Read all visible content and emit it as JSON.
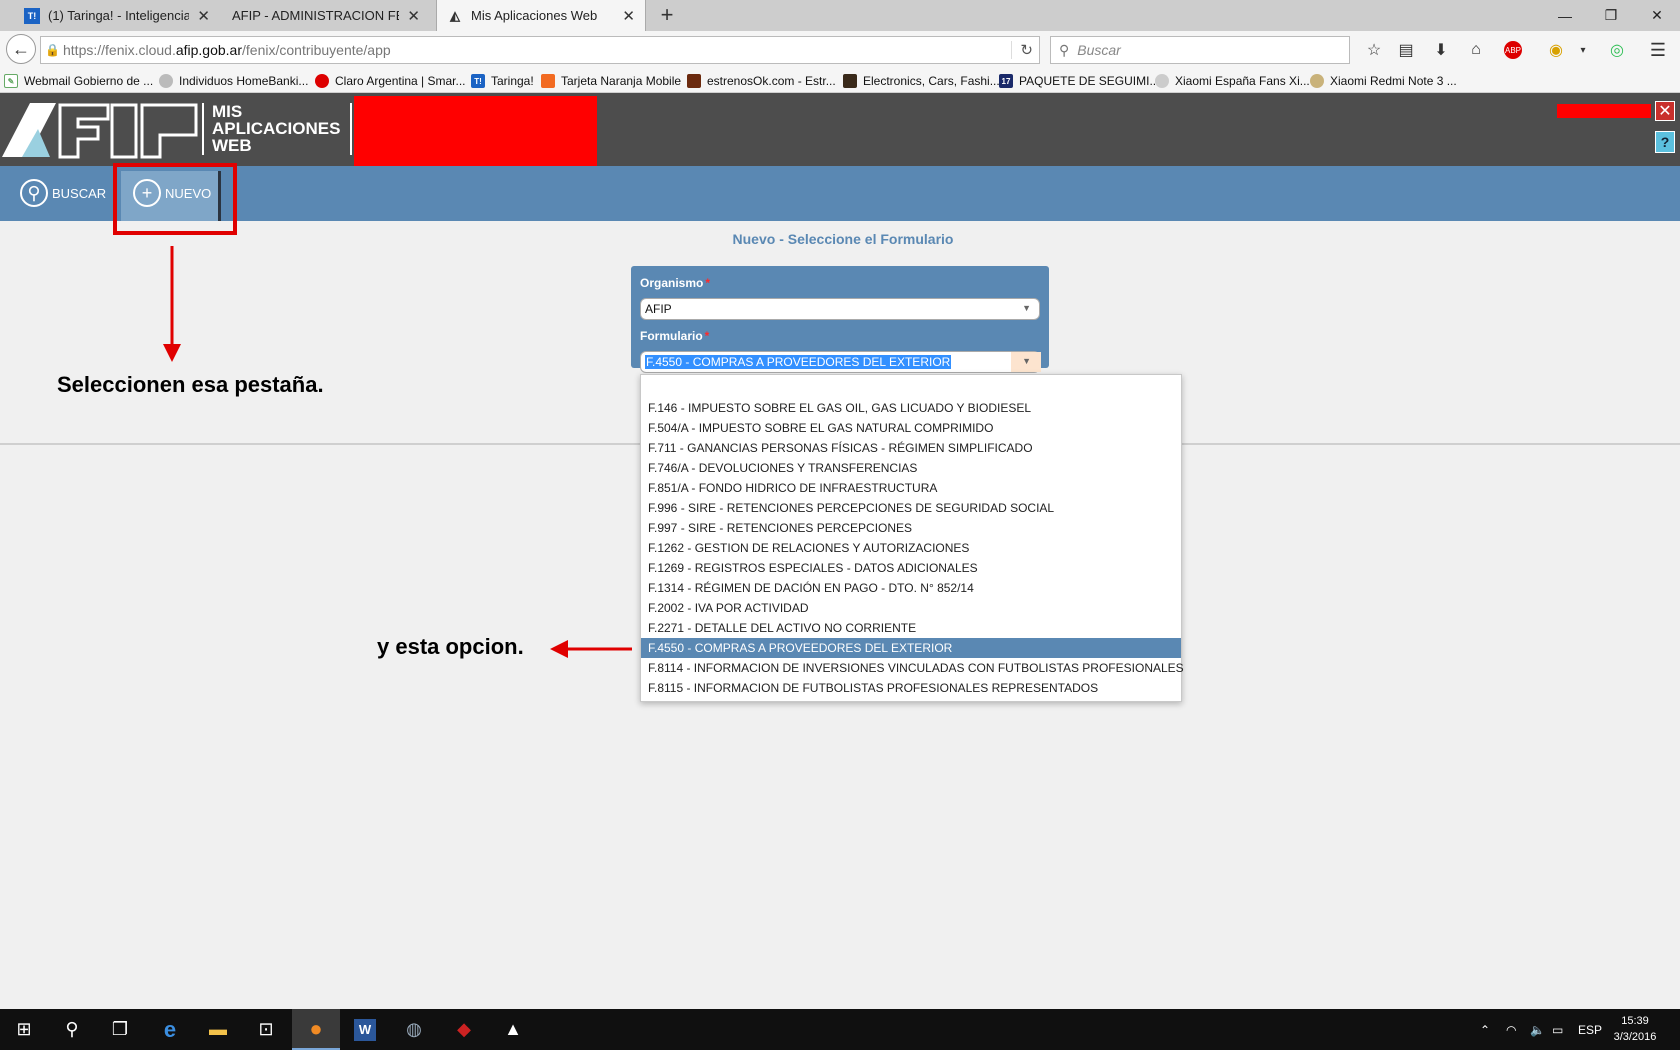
{
  "browser": {
    "tabs": [
      {
        "title": "(1) Taringa! - Inteligencia ...",
        "icon": "T!",
        "active": false
      },
      {
        "title": "AFIP - ADMINISTRACION FED...",
        "icon": "",
        "active": false
      },
      {
        "title": "Mis Aplicaciones Web",
        "icon": "",
        "active": true
      }
    ],
    "url": {
      "prefix": "https://fenix.cloud.",
      "domain": "afip.gob.ar",
      "path": "/fenix/contribuyente/app"
    },
    "search_placeholder": "Buscar",
    "bookmarks": [
      "Webmail Gobierno de ...",
      "Individuos HomeBanki...",
      "Claro Argentina | Smar...",
      "Taringa!",
      "Tarjeta Naranja Mobile",
      "estrenosOk.com - Estr...",
      "Electronics, Cars, Fashi...",
      "PAQUETE DE SEGUIMI...",
      "Xiaomi España Fans Xi...",
      "Xiaomi Redmi Note 3 ..."
    ]
  },
  "app": {
    "name_lines": [
      "MIS",
      "APLICACIONES",
      "WEB"
    ],
    "help_label": "?",
    "toolbar": {
      "buscar": "BUSCAR",
      "nuevo": "NUEVO"
    },
    "page_title": "Nuevo - Seleccione el Formulario",
    "form": {
      "organismo_label": "Organismo",
      "organismo_value": "AFIP",
      "formulario_label": "Formulario",
      "formulario_value": "F.4550 - COMPRAS A PROVEEDORES DEL EXTERIOR",
      "required_mark": "*"
    },
    "dropdown_options": [
      "F.146 - IMPUESTO SOBRE EL GAS OIL, GAS LICUADO Y BIODIESEL",
      "F.504/A - IMPUESTO SOBRE EL GAS NATURAL COMPRIMIDO",
      "F.711 - GANANCIAS PERSONAS FÍSICAS - RÉGIMEN SIMPLIFICADO",
      "F.746/A - DEVOLUCIONES Y TRANSFERENCIAS",
      "F.851/A - FONDO HIDRICO DE INFRAESTRUCTURA",
      "F.996 - SIRE - RETENCIONES PERCEPCIONES DE SEGURIDAD SOCIAL",
      "F.997 - SIRE - RETENCIONES PERCEPCIONES",
      "F.1262 - GESTION DE RELACIONES Y AUTORIZACIONES",
      "F.1269 - REGISTROS ESPECIALES - DATOS ADICIONALES",
      "F.1314 - RÉGIMEN DE DACIÓN EN PAGO - DTO. N° 852/14",
      "F.2002 - IVA POR ACTIVIDAD",
      "F.2271 - DETALLE DEL ACTIVO NO CORRIENTE",
      "F.4550 - COMPRAS A PROVEEDORES DEL EXTERIOR",
      "F.8114 - INFORMACION DE INVERSIONES VINCULADAS CON FUTBOLISTAS PROFESIONALES",
      "F.8115 - INFORMACION DE FUTBOLISTAS PROFESIONALES REPRESENTADOS"
    ],
    "selected_option_index": 12
  },
  "annotations": {
    "note1": "Seleccionen esa pestaña.",
    "note2": "y esta opcion."
  },
  "taskbar": {
    "lang": "ESP",
    "time": "15:39",
    "date": "3/3/2016"
  },
  "colors": {
    "accent": "#5a88b3",
    "annotation_red": "#e00000"
  }
}
